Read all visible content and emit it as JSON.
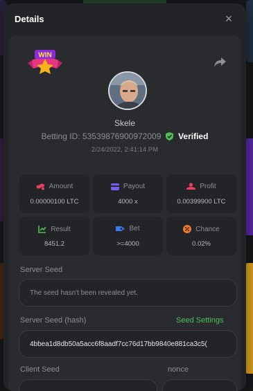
{
  "modal": {
    "title": "Details",
    "close_label": "×"
  },
  "bet": {
    "player_name": "Skele",
    "betting_id_label": "Betting ID:",
    "betting_id": "53539876900972009",
    "verified_label": "Verified",
    "timestamp": "2/24/2022, 2:41:14 PM",
    "badge_text": "WIN"
  },
  "stats": [
    {
      "label": "Amount",
      "value": "0.00000100 LTC",
      "icon": "coins-icon",
      "color": "#e8425f"
    },
    {
      "label": "Payout",
      "value": "4000 x",
      "icon": "wallet-icon",
      "color": "#7c5cf0"
    },
    {
      "label": "Profit",
      "value": "0.00399900 LTC",
      "icon": "profit-icon",
      "color": "#e8425f"
    },
    {
      "label": "Result",
      "value": "8451.2",
      "icon": "result-icon",
      "color": "#4fbf59"
    },
    {
      "label": "Bet",
      "value": ">=4000",
      "icon": "bet-icon",
      "color": "#3d7bf0"
    },
    {
      "label": "Chance",
      "value": "0.02%",
      "icon": "chance-icon",
      "color": "#f07a2a"
    }
  ],
  "seeds": {
    "server_seed_label": "Server Seed",
    "server_seed_value": "The seed hasn't been revealed yet.",
    "server_seed_hash_label": "Server Seed (hash)",
    "seed_settings_label": "Seed Settings",
    "server_seed_hash_value": "4bbea1d8db50a5acc6f8aadf7cc76d17bb9840e881ca3c5(",
    "client_seed_label": "Client Seed",
    "nonce_label": "nonce"
  },
  "colors": {
    "accent_green": "#4fbf59",
    "modal_bg": "#232427",
    "card_bg": "#2a2b2f"
  }
}
